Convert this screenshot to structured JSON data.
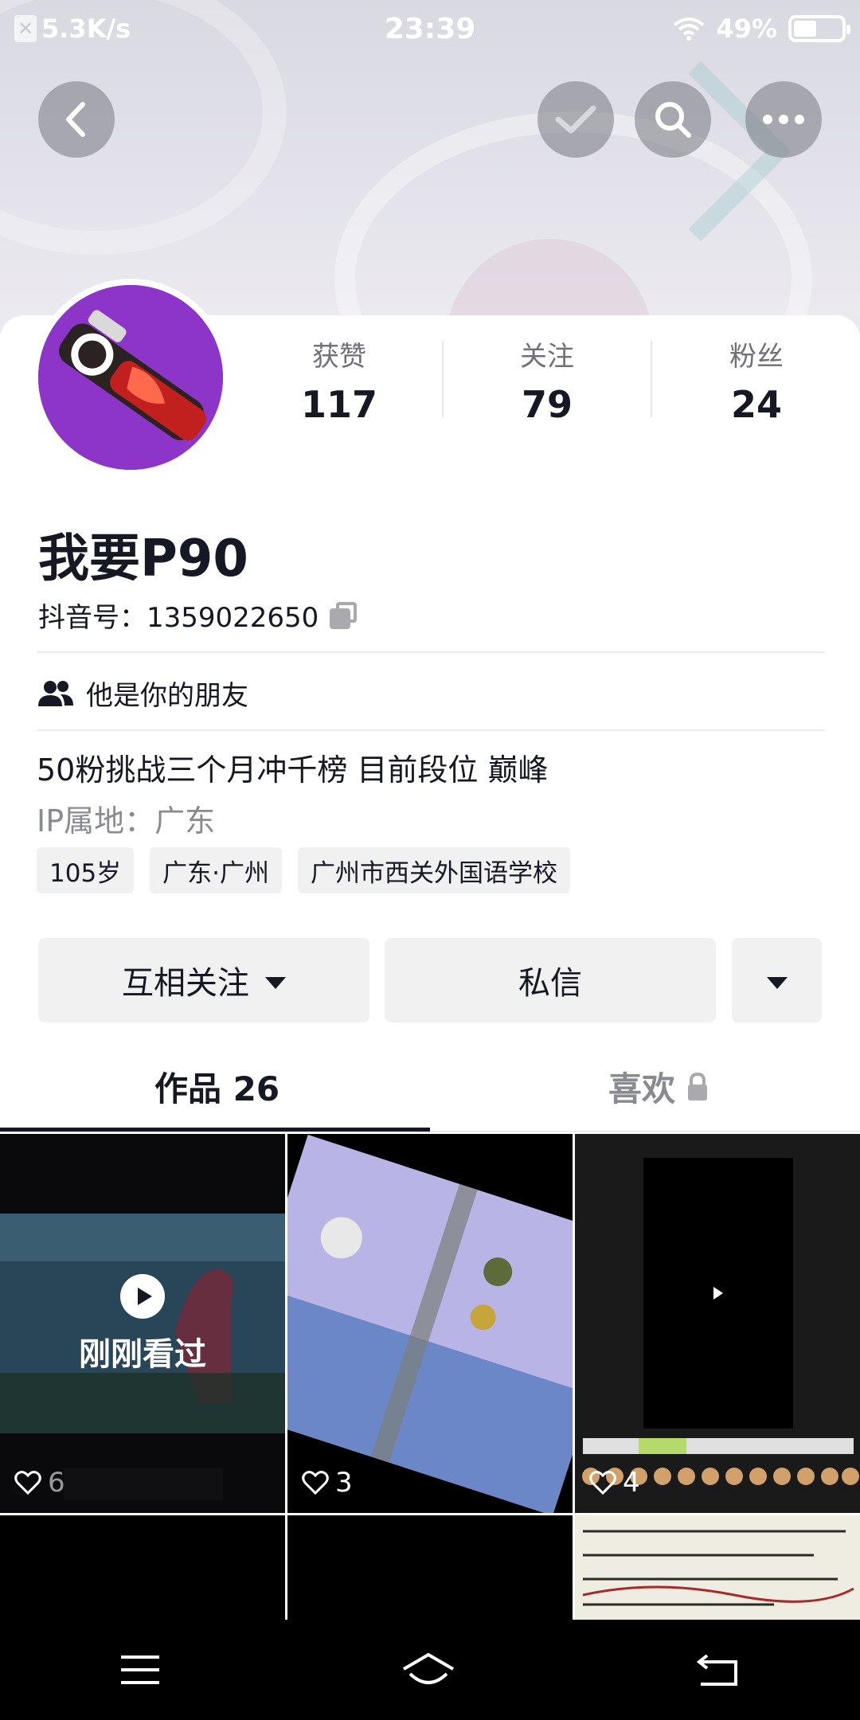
{
  "status_bar": {
    "net_speed": "5.3K/s",
    "time": "23:39",
    "battery": "49%",
    "battery_level": 0.49
  },
  "header": {
    "back_icon": "chevron-left-icon",
    "check_icon": "check-icon",
    "search_icon": "search-icon",
    "more_icon": "more-horizontal-icon"
  },
  "profile": {
    "stats": [
      {
        "label": "获赞",
        "value": "117"
      },
      {
        "label": "关注",
        "value": "79"
      },
      {
        "label": "粉丝",
        "value": "24"
      }
    ],
    "name": "我要P90",
    "douyin_id": "抖音号：1359022650",
    "friend_note": "他是你的朋友",
    "bio": "50粉挑战三个月冲千榜 目前段位 巅峰",
    "ip_location": "IP属地：广东",
    "tags": [
      "105岁",
      "广东·广州",
      "广州市西关外国语学校"
    ]
  },
  "actions": {
    "follow_label": "互相关注",
    "message_label": "私信"
  },
  "tabs": [
    {
      "label": "作品 26",
      "active": true
    },
    {
      "label": "喜欢",
      "active": false,
      "locked": true
    }
  ],
  "videos": [
    {
      "likes": "6",
      "overlay": "刚刚看过"
    },
    {
      "likes": "3"
    },
    {
      "likes": "4"
    },
    {},
    {},
    {}
  ],
  "colors": {
    "avatar_bg": "#8c35c8",
    "button_bg": "#f1f1f2",
    "text_primary": "#161823",
    "text_secondary": "#8a8b91"
  }
}
